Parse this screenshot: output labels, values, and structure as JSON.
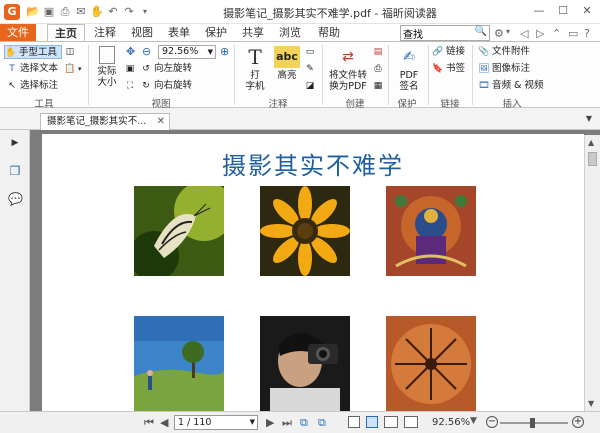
{
  "window": {
    "title": "摄影笔记_摄影其实不难学.pdf - 福昕阅读器",
    "logo_letter": "G"
  },
  "tabs": {
    "file": "文件",
    "home": "主页",
    "comment": "注释",
    "view": "视图",
    "form": "表单",
    "protect": "保护",
    "share": "共享",
    "browse": "浏览",
    "help": "帮助"
  },
  "search": {
    "value": "查找"
  },
  "ribbon": {
    "tools": {
      "hand": "手型工具",
      "select_text": "选择文本",
      "select_annotation": "选择标注",
      "label": "工具"
    },
    "view": {
      "actual_size": "实际\n大小",
      "zoom_value": "92.56%",
      "rotate_left": "向左旋转",
      "rotate_right": "向右旋转",
      "label": "视图"
    },
    "annotation": {
      "typewriter": "打\n字机",
      "highlight": "高亮",
      "highlight_abc": "abc",
      "label": "注释"
    },
    "create": {
      "convert": "将文件转\n换为PDF",
      "label": "创建"
    },
    "protect": {
      "sign": "PDF\n签名",
      "label": "保护"
    },
    "links": {
      "link": "链接",
      "bookmark": "书签",
      "label": "链接"
    },
    "insert": {
      "attachment": "文件附件",
      "image": "图像标注",
      "media": "音频 & 视频",
      "label": "插入"
    }
  },
  "document": {
    "tab_title": "摄影笔记_摄影其实不...",
    "page_title": "摄影其实不难学"
  },
  "statusbar": {
    "page_value": "1 / 110",
    "zoom_percent": "92.56%"
  },
  "colors": {
    "accent": "#e8661c",
    "title_blue": "#1f5f9f",
    "canvas_gray": "#7c7c7c"
  }
}
